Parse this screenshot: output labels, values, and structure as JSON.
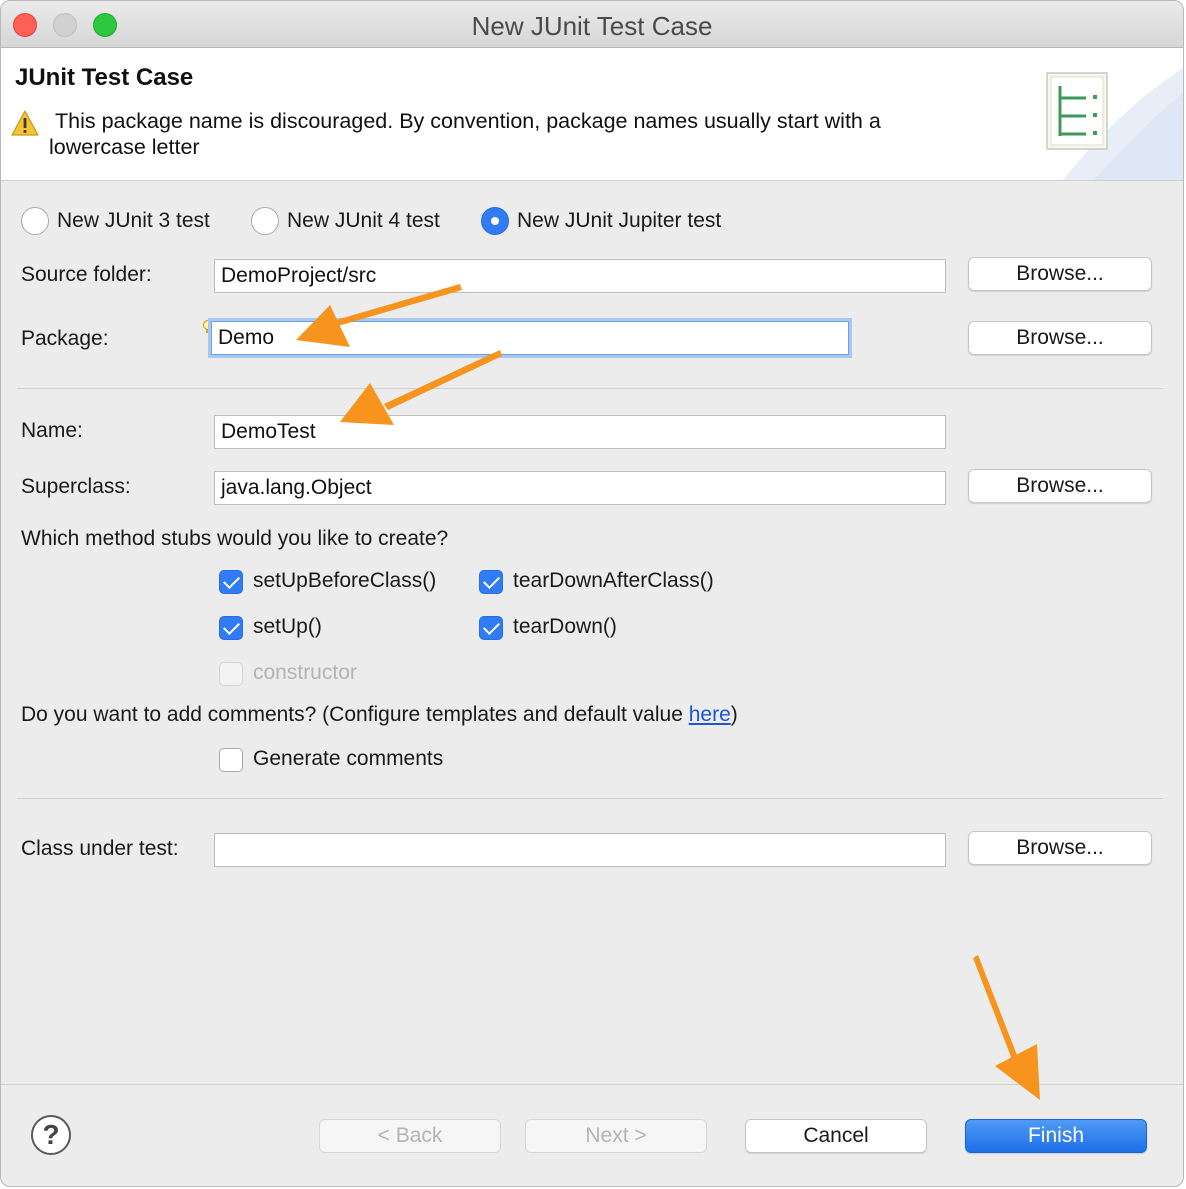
{
  "window": {
    "title": "New JUnit Test Case"
  },
  "header": {
    "title": "JUnit Test Case",
    "message_line1": "This package name is discouraged. By convention, package names usually start with a",
    "message_line2": "lowercase letter",
    "warning_icon": "warning-icon",
    "wizard_icon": "junit-wizard-icon"
  },
  "test_type": {
    "options": [
      "New JUnit 3 test",
      "New JUnit 4 test",
      "New JUnit Jupiter test"
    ],
    "selected": "New JUnit Jupiter test"
  },
  "source_folder": {
    "label": "Source folder:",
    "value": "DemoProject/src",
    "browse": "Browse..."
  },
  "package": {
    "label": "Package:",
    "value": "Demo",
    "browse": "Browse..."
  },
  "name": {
    "label": "Name:",
    "value": "DemoTest"
  },
  "superclass": {
    "label": "Superclass:",
    "value": "java.lang.Object",
    "browse": "Browse..."
  },
  "method_stubs": {
    "question": "Which method stubs would you like to create?",
    "items": [
      {
        "label": "setUpBeforeClass()",
        "checked": true,
        "enabled": true
      },
      {
        "label": "tearDownAfterClass()",
        "checked": true,
        "enabled": true
      },
      {
        "label": "setUp()",
        "checked": true,
        "enabled": true
      },
      {
        "label": "tearDown()",
        "checked": true,
        "enabled": true
      },
      {
        "label": "constructor",
        "checked": false,
        "enabled": false
      }
    ]
  },
  "comments": {
    "question_prefix": "Do you want to add comments? (Configure templates and default value ",
    "link": "here",
    "question_suffix": ")",
    "generate_label": "Generate comments",
    "generate_checked": false
  },
  "class_under_test": {
    "label": "Class under test:",
    "value": "",
    "browse": "Browse..."
  },
  "footer": {
    "help": "?",
    "back": "< Back",
    "next": "Next >",
    "cancel": "Cancel",
    "finish": "Finish"
  },
  "colors": {
    "accent": "#2f7cf6",
    "annotation_arrow": "#f7941d"
  }
}
